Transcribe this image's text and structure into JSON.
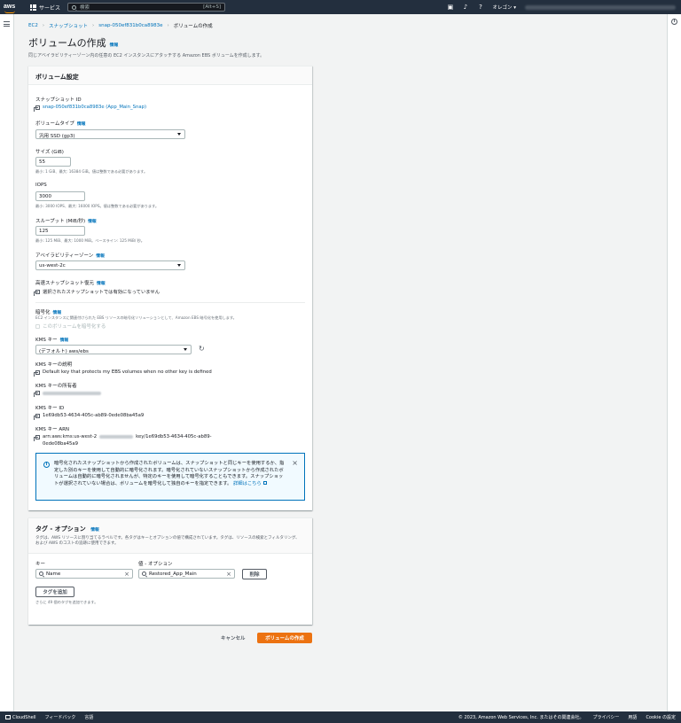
{
  "topbar": {
    "services": "サービス",
    "search_placeholder": "検索",
    "search_hint": "[Alt+S]",
    "region": "オレゴン ▾"
  },
  "breadcrumb": [
    "EC2",
    "スナップショット",
    "snap-050ef831b0ca8983e",
    "ボリュームの作成"
  ],
  "page": {
    "title": "ボリュームの作成",
    "info": "情報",
    "description": "同じアベイラビリティーゾーン内の任意の EC2 インスタンスにアタッチする Amazon EBS ボリュームを作成します。"
  },
  "settings": {
    "header": "ボリューム設定",
    "snapshot_id_label": "スナップショット ID",
    "snapshot_id_value": "snap-050ef831b0ca8983e (App_Main_Snap)",
    "volume_type_label": "ボリュームタイプ",
    "volume_type_value": "汎用 SSD (gp3)",
    "size_label": "サイズ (GiB)",
    "size_value": "55",
    "size_constraint": "最小: 1 GiB、最大: 16384 GiB。値は整数である必要があります。",
    "iops_label": "IOPS",
    "iops_value": "3000",
    "iops_constraint": "最小: 3000 IOPS、最大: 16000 IOPS。値は整数である必要があります。",
    "throughput_label": "スループット (MiB/秒)",
    "throughput_value": "125",
    "throughput_constraint": "最小: 125 MiB、最大: 1000 MiB。ベースライン: 125 MiB/ 秒。",
    "az_label": "アベイラビリティーゾーン",
    "az_value": "us-west-2c",
    "fast_restore_label": "高速スナップショット復元",
    "fast_restore_value": "選択されたスナップショットでは有効になっていません",
    "encryption_label": "暗号化",
    "encryption_desc": "EC2 インスタンスに関連付けられた EBS リソースの暗号化ソリューションとして、Amazon EBS 暗号化を使用します。",
    "encrypt_checkbox": "このボリュームを暗号化する",
    "kms_key_label": "KMS キー",
    "kms_key_value": "(デフォルト) aws/ebs",
    "kms_desc_label": "KMS キーの説明",
    "kms_desc_value": "Default key that protects my EBS volumes when no other key is defined",
    "kms_owner_label": "KMS キーの所有者",
    "kms_id_label": "KMS キー ID",
    "kms_id_value": "1e69db53-4634-405c-ab89-0ede08ba45a9",
    "kms_arn_label": "KMS キー ARN",
    "kms_arn_prefix": "arn:aws:kms:us-west-2",
    "kms_arn_suffix": "key/1e69db53-4634-405c-ab89-",
    "kms_arn_line2": "0ede08ba45a9",
    "alert_text": "暗号化されたスナップショットから作成されたボリュームは、スナップショットと同じキーを使用するか、指定した別のキーを使用して自動的に暗号化されます。暗号化されていないスナップショットから作成されたボリュームは自動的に暗号化されませんが、特定のキーを使用して暗号化することもできます。スナップショットが選択されていない場合は、ボリュームを暗号化して独自のキーを指定できます。",
    "alert_link": "詳細はこちら"
  },
  "tags": {
    "header": "タグ - オプション",
    "info": "情報",
    "description": "タグは、AWS リソースに割り当てるラベルです。各タグはキーとオプションの値で構成されています。タグは、リソースの検索とフィルタリング、および AWS のコストの追跡に使用できます。",
    "key_label": "キー",
    "value_label": "値 - オプション",
    "key_value": "Name",
    "value_value": "Restored_App_Main",
    "remove_button": "削除",
    "add_button": "タグを追加",
    "remaining": "さらに 49 個のタグを追加できます。"
  },
  "actions": {
    "cancel": "キャンセル",
    "create": "ボリュームの作成"
  },
  "footer": {
    "cloudshell": "CloudShell",
    "feedback": "フィードバック",
    "language": "言語",
    "copyright": "© 2023, Amazon Web Services, Inc. またはその関連会社。",
    "privacy": "プライバシー",
    "terms": "用語",
    "cookie": "Cookie の設定"
  }
}
